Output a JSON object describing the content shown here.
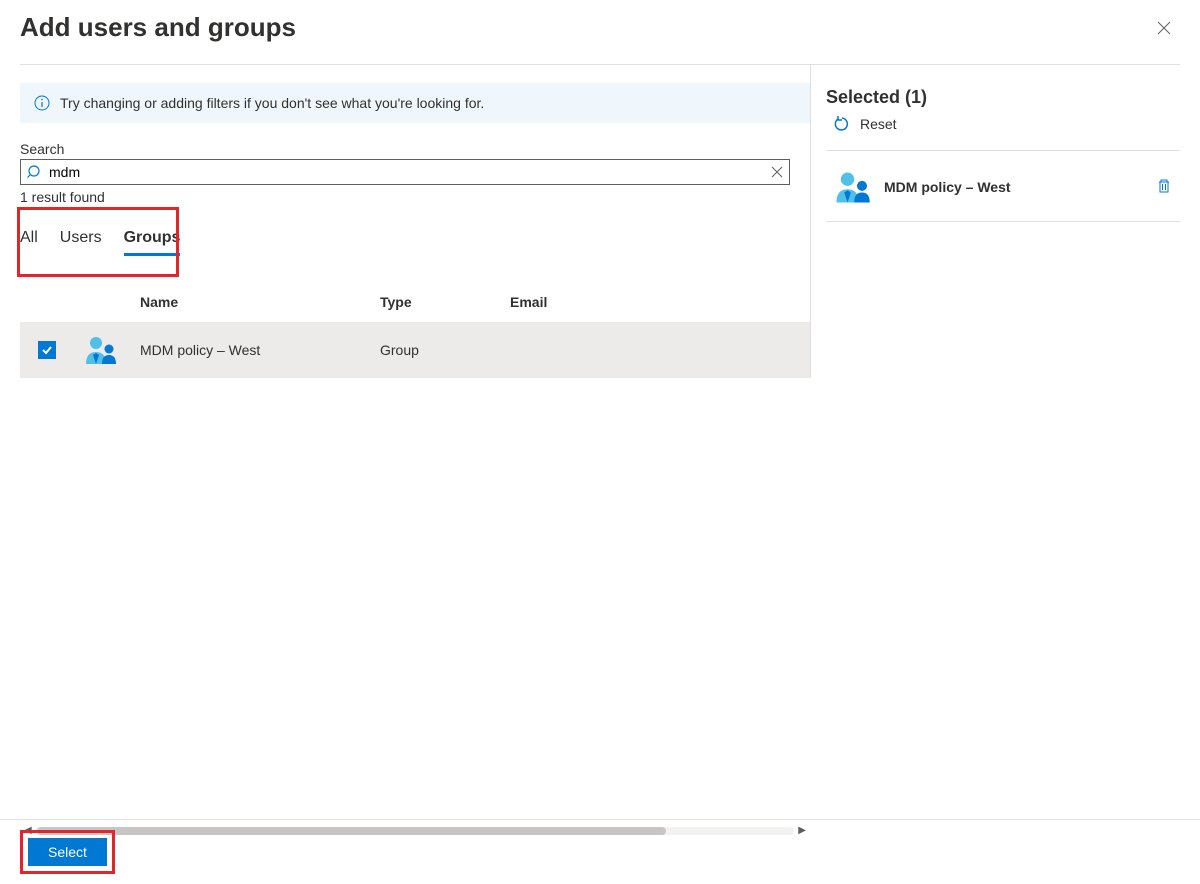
{
  "header": {
    "title": "Add users and groups"
  },
  "info": {
    "message": "Try changing or adding filters if you don't see what you're looking for."
  },
  "search": {
    "label": "Search",
    "value": "mdm",
    "result_count": "1 result found"
  },
  "tabs": {
    "all": "All",
    "users": "Users",
    "groups": "Groups"
  },
  "columns": {
    "name": "Name",
    "type": "Type",
    "email": "Email"
  },
  "results": {
    "row0": {
      "name": "MDM policy – West",
      "type": "Group",
      "email": ""
    }
  },
  "selected": {
    "heading": "Selected (1)",
    "reset": "Reset",
    "item0": {
      "name": "MDM policy – West"
    }
  },
  "footer": {
    "select": "Select"
  }
}
